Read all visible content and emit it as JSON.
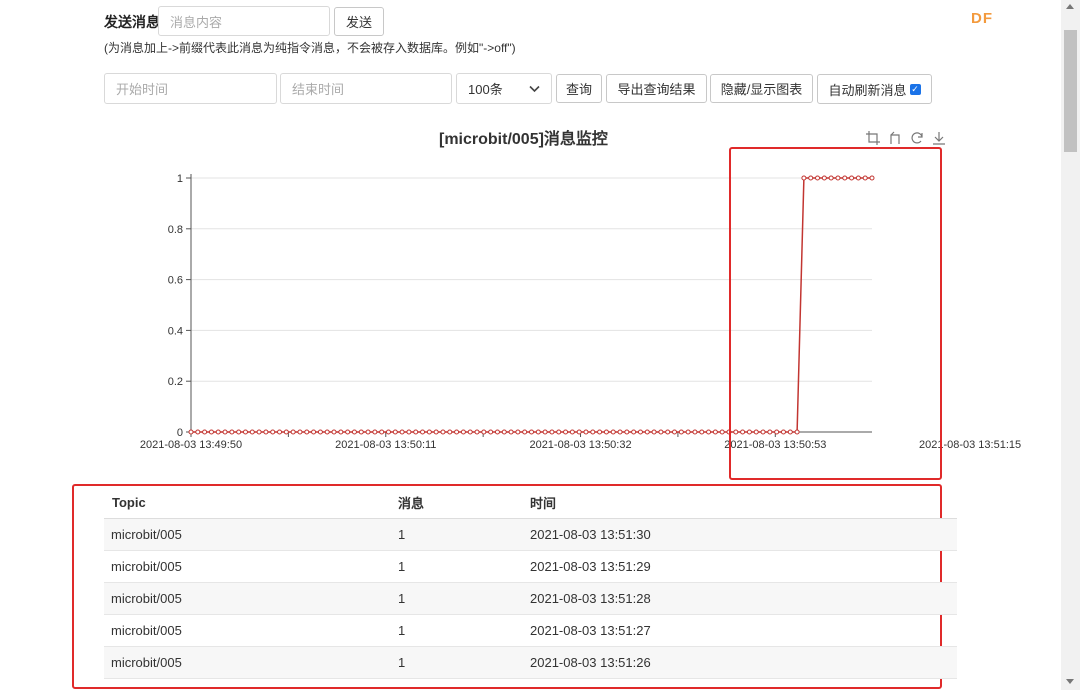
{
  "brand": "DF",
  "send": {
    "label": "发送消息",
    "placeholder": "消息内容",
    "button": "发送",
    "hint": "(为消息加上->前缀代表此消息为纯指令消息，不会被存入数据库。例如\"->off\")"
  },
  "query": {
    "start_placeholder": "开始时间",
    "end_placeholder": "结束时间",
    "limit_selected": "100条",
    "query_button": "查询",
    "export_button": "导出查询结果",
    "toggle_chart_button": "隐藏/显示图表",
    "auto_refresh_label": "自动刷新消息",
    "auto_refresh_checked": true
  },
  "chart_toolbar": [
    "crop-icon",
    "undo-icon",
    "refresh-icon",
    "download-icon"
  ],
  "chart_data": {
    "type": "line",
    "title": "[microbit/005]消息监控",
    "xlabel": "",
    "ylabel": "",
    "ylim": [
      0,
      1
    ],
    "yticks": [
      "0",
      "0.2",
      "0.4",
      "0.6",
      "0.8",
      "1"
    ],
    "xtick_labels": [
      "2021-08-03 13:49:50",
      "2021-08-03 13:50:11",
      "2021-08-03 13:50:32",
      "2021-08-03 13:50:53",
      "2021-08-03 13:51:15"
    ],
    "color": "#c23531",
    "series": [
      {
        "values": [
          0,
          0,
          0,
          0,
          0,
          0,
          0,
          0,
          0,
          0,
          0,
          0,
          0,
          0,
          0,
          0,
          0,
          0,
          0,
          0,
          0,
          0,
          0,
          0,
          0,
          0,
          0,
          0,
          0,
          0,
          0,
          0,
          0,
          0,
          0,
          0,
          0,
          0,
          0,
          0,
          0,
          0,
          0,
          0,
          0,
          0,
          0,
          0,
          0,
          0,
          0,
          0,
          0,
          0,
          0,
          0,
          0,
          0,
          0,
          0,
          0,
          0,
          0,
          0,
          0,
          0,
          0,
          0,
          0,
          0,
          0,
          0,
          0,
          0,
          0,
          0,
          0,
          0,
          0,
          0,
          0,
          0,
          0,
          0,
          0,
          0,
          0,
          0,
          0,
          0,
          1,
          1,
          1,
          1,
          1,
          1,
          1,
          1,
          1,
          1,
          1
        ]
      }
    ],
    "grid": true
  },
  "table": {
    "headers": [
      "Topic",
      "消息",
      "时间"
    ],
    "rows": [
      [
        "microbit/005",
        "1",
        "2021-08-03 13:51:30"
      ],
      [
        "microbit/005",
        "1",
        "2021-08-03 13:51:29"
      ],
      [
        "microbit/005",
        "1",
        "2021-08-03 13:51:28"
      ],
      [
        "microbit/005",
        "1",
        "2021-08-03 13:51:27"
      ],
      [
        "microbit/005",
        "1",
        "2021-08-03 13:51:26"
      ]
    ]
  }
}
